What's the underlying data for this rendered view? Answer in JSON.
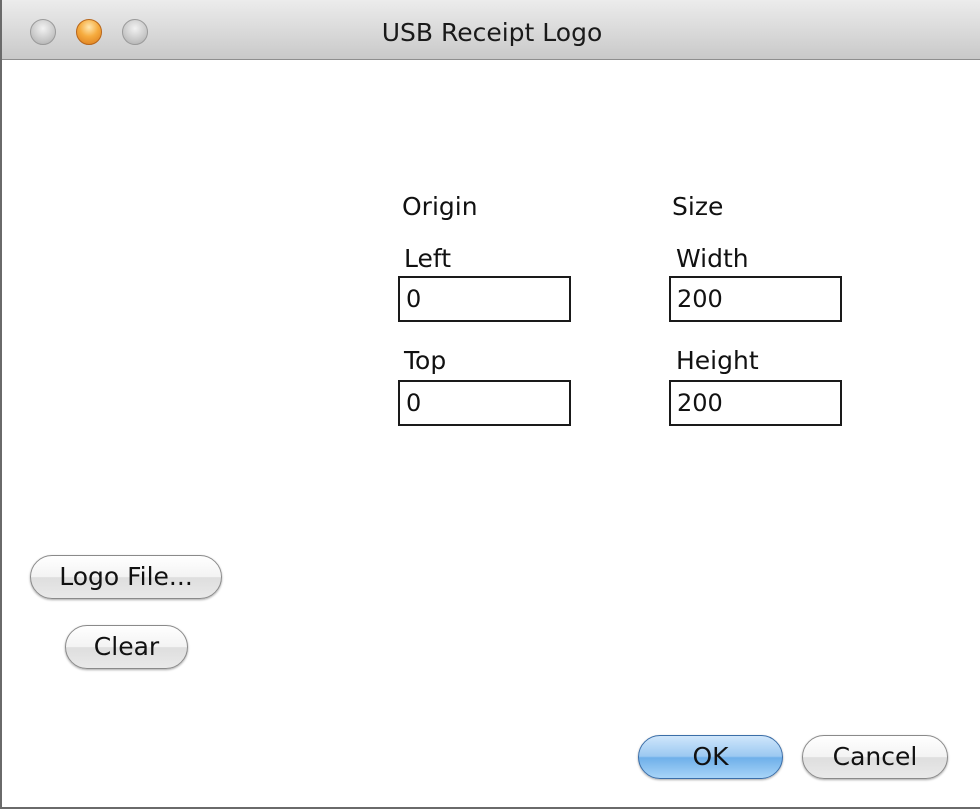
{
  "window": {
    "title": "USB Receipt Logo"
  },
  "origin": {
    "heading": "Origin",
    "left_label": "Left",
    "left_value": "0",
    "top_label": "Top",
    "top_value": "0"
  },
  "size": {
    "heading": "Size",
    "width_label": "Width",
    "width_value": "200",
    "height_label": "Height",
    "height_value": "200"
  },
  "buttons": {
    "logo_file": "Logo File...",
    "clear": "Clear",
    "ok": "OK",
    "cancel": "Cancel"
  },
  "colors": {
    "default_button": "#8fc2f0",
    "close_button": "#f0a030"
  }
}
